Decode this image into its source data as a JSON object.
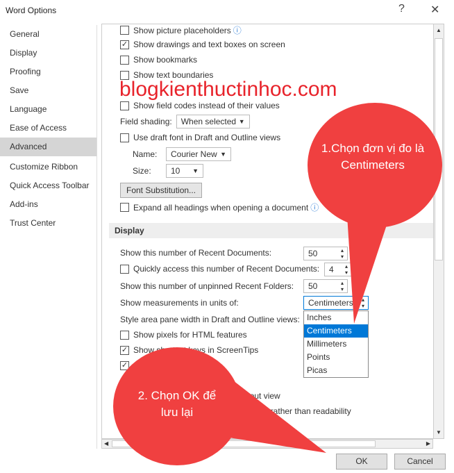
{
  "window": {
    "title": "Word Options",
    "help": "?",
    "close": "✕"
  },
  "sidebar": {
    "items": [
      {
        "label": "General"
      },
      {
        "label": "Display"
      },
      {
        "label": "Proofing"
      },
      {
        "label": "Save"
      },
      {
        "label": "Language"
      },
      {
        "label": "Ease of Access"
      },
      {
        "label": "Advanced",
        "active": true
      },
      {
        "label": "Customize Ribbon"
      },
      {
        "label": "Quick Access Toolbar"
      },
      {
        "label": "Add-ins"
      },
      {
        "label": "Trust Center"
      }
    ]
  },
  "content": {
    "show_picture_placeholders": "Show picture placeholders",
    "show_drawings": "Show drawings and text boxes on screen",
    "show_bookmarks": "Show bookmarks",
    "show_text_boundaries": "Show text boundaries",
    "show_field_codes": "Show field codes instead of their values",
    "field_shading_label": "Field shading:",
    "field_shading_value": "When selected",
    "use_draft_font": "Use draft font in Draft and Outline views",
    "name_label": "Name:",
    "name_value": "Courier New",
    "size_label": "Size:",
    "size_value": "10",
    "font_substitution": "Font Substitution...",
    "expand_headings": "Expand all headings when opening a document",
    "display_section": "Display",
    "recent_docs_label": "Show this number of Recent Documents:",
    "recent_docs_value": "50",
    "quick_access_label": "Quickly access this number of Recent Documents:",
    "quick_access_value": "4",
    "recent_folders_label": "Show this number of unpinned Recent Folders:",
    "recent_folders_value": "50",
    "units_label": "Show measurements in units of:",
    "units_value": "Centimeters",
    "style_area_label": "Style area pane width in Draft and Outline views:",
    "show_pixels": "Show pixels for HTML features",
    "show_shortcut": "Show shortcut keys in ScreenTips",
    "partial_a": "r",
    "partial_b": "ayout view",
    "partial_c": "r layout rather than readability"
  },
  "units_options": [
    "Inches",
    "Centimeters",
    "Millimeters",
    "Points",
    "Picas"
  ],
  "units_selected": "Centimeters",
  "buttons": {
    "ok": "OK",
    "cancel": "Cancel"
  },
  "annotations": {
    "watermark": "blogkienthuctinhoc.com",
    "callout1": "1.Chọn đơn vị đo là Centimeters",
    "callout2": "2. Chọn OK để lưu lại",
    "color": "#f04040"
  }
}
